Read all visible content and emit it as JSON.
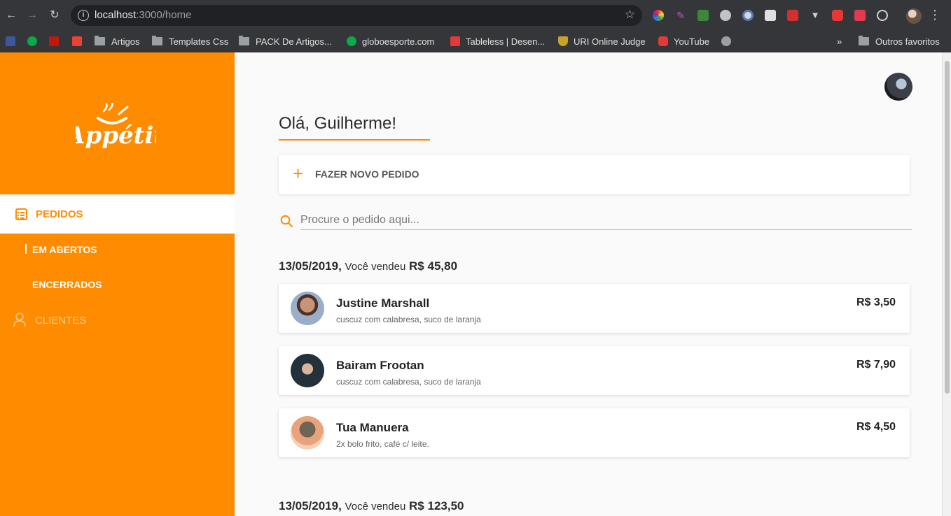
{
  "browser": {
    "url_host": "localhost",
    "url_rest": ":3000/home",
    "bookmarks": [
      "Artigos",
      "Templates Css",
      "PACK De Artigos...",
      "globoesporte.com",
      "Tableless | Desen...",
      "URI Online Judge",
      "YouTube"
    ],
    "bookmarks_more": "»",
    "other_favorites": "Outros favoritos"
  },
  "sidebar": {
    "brand": "Appétit",
    "nav": {
      "orders": "PEDIDOS",
      "open": "EM ABERTOS",
      "closed": "ENCERRADOS",
      "clients": "CLIENTES"
    }
  },
  "main": {
    "greeting": "Olá, Guilherme!",
    "new_order": "FAZER NOVO PEDIDO",
    "search_placeholder": "Procure o pedido aqui...",
    "days": [
      {
        "date": "13/05/2019,",
        "text": "Você vendeu",
        "amount": "R$ 45,80",
        "orders": [
          {
            "name": "Justine Marshall",
            "items": "cuscuz com calabresa, suco de laranja",
            "price": "R$ 3,50"
          },
          {
            "name": "Bairam Frootan",
            "items": "cuscuz com calabresa, suco de laranja",
            "price": "R$ 7,90"
          },
          {
            "name": "Tua Manuera",
            "items": "2x bolo frito, café c/ leite.",
            "price": "R$ 4,50"
          }
        ]
      },
      {
        "date": "13/05/2019,",
        "text": "Você vendeu",
        "amount": "R$ 123,50",
        "orders": []
      }
    ]
  },
  "colors": {
    "accent": "#ff8c00",
    "sidebar_bg": "#ff8c00",
    "page_bg": "#fafafa"
  }
}
